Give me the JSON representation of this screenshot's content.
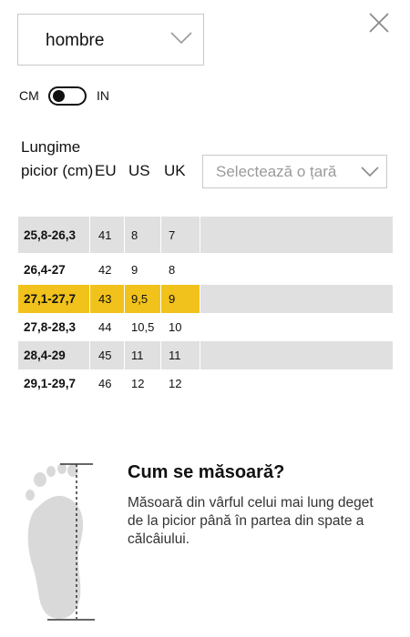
{
  "gender_select": {
    "value": "hombre"
  },
  "unit_toggle": {
    "left_label": "CM",
    "right_label": "IN"
  },
  "table": {
    "headers": {
      "length": "Lungime picior (cm)",
      "eu": "EU",
      "us": "US",
      "uk": "UK"
    },
    "country_placeholder": "Selectează o țară",
    "rows": [
      {
        "length": "25,8-26,3",
        "eu": "41",
        "us": "8",
        "uk": "7"
      },
      {
        "length": "26,4-27",
        "eu": "42",
        "us": "9",
        "uk": "8"
      },
      {
        "length": "27,1-27,7",
        "eu": "43",
        "us": "9,5",
        "uk": "9"
      },
      {
        "length": "27,8-28,3",
        "eu": "44",
        "us": "10,5",
        "uk": "10"
      },
      {
        "length": "28,4-29",
        "eu": "45",
        "us": "11",
        "uk": "11"
      },
      {
        "length": "29,1-29,7",
        "eu": "46",
        "us": "12",
        "uk": "12"
      }
    ]
  },
  "how_to_measure": {
    "title": "Cum se măsoară?",
    "text": "Măsoară din vârful celui mai lung deget de la picior până în partea din spate a călcâiului."
  },
  "colors": {
    "highlight": "#f1c21b",
    "row_shade": "#e0e0e0",
    "border": "#c9c9c9"
  }
}
